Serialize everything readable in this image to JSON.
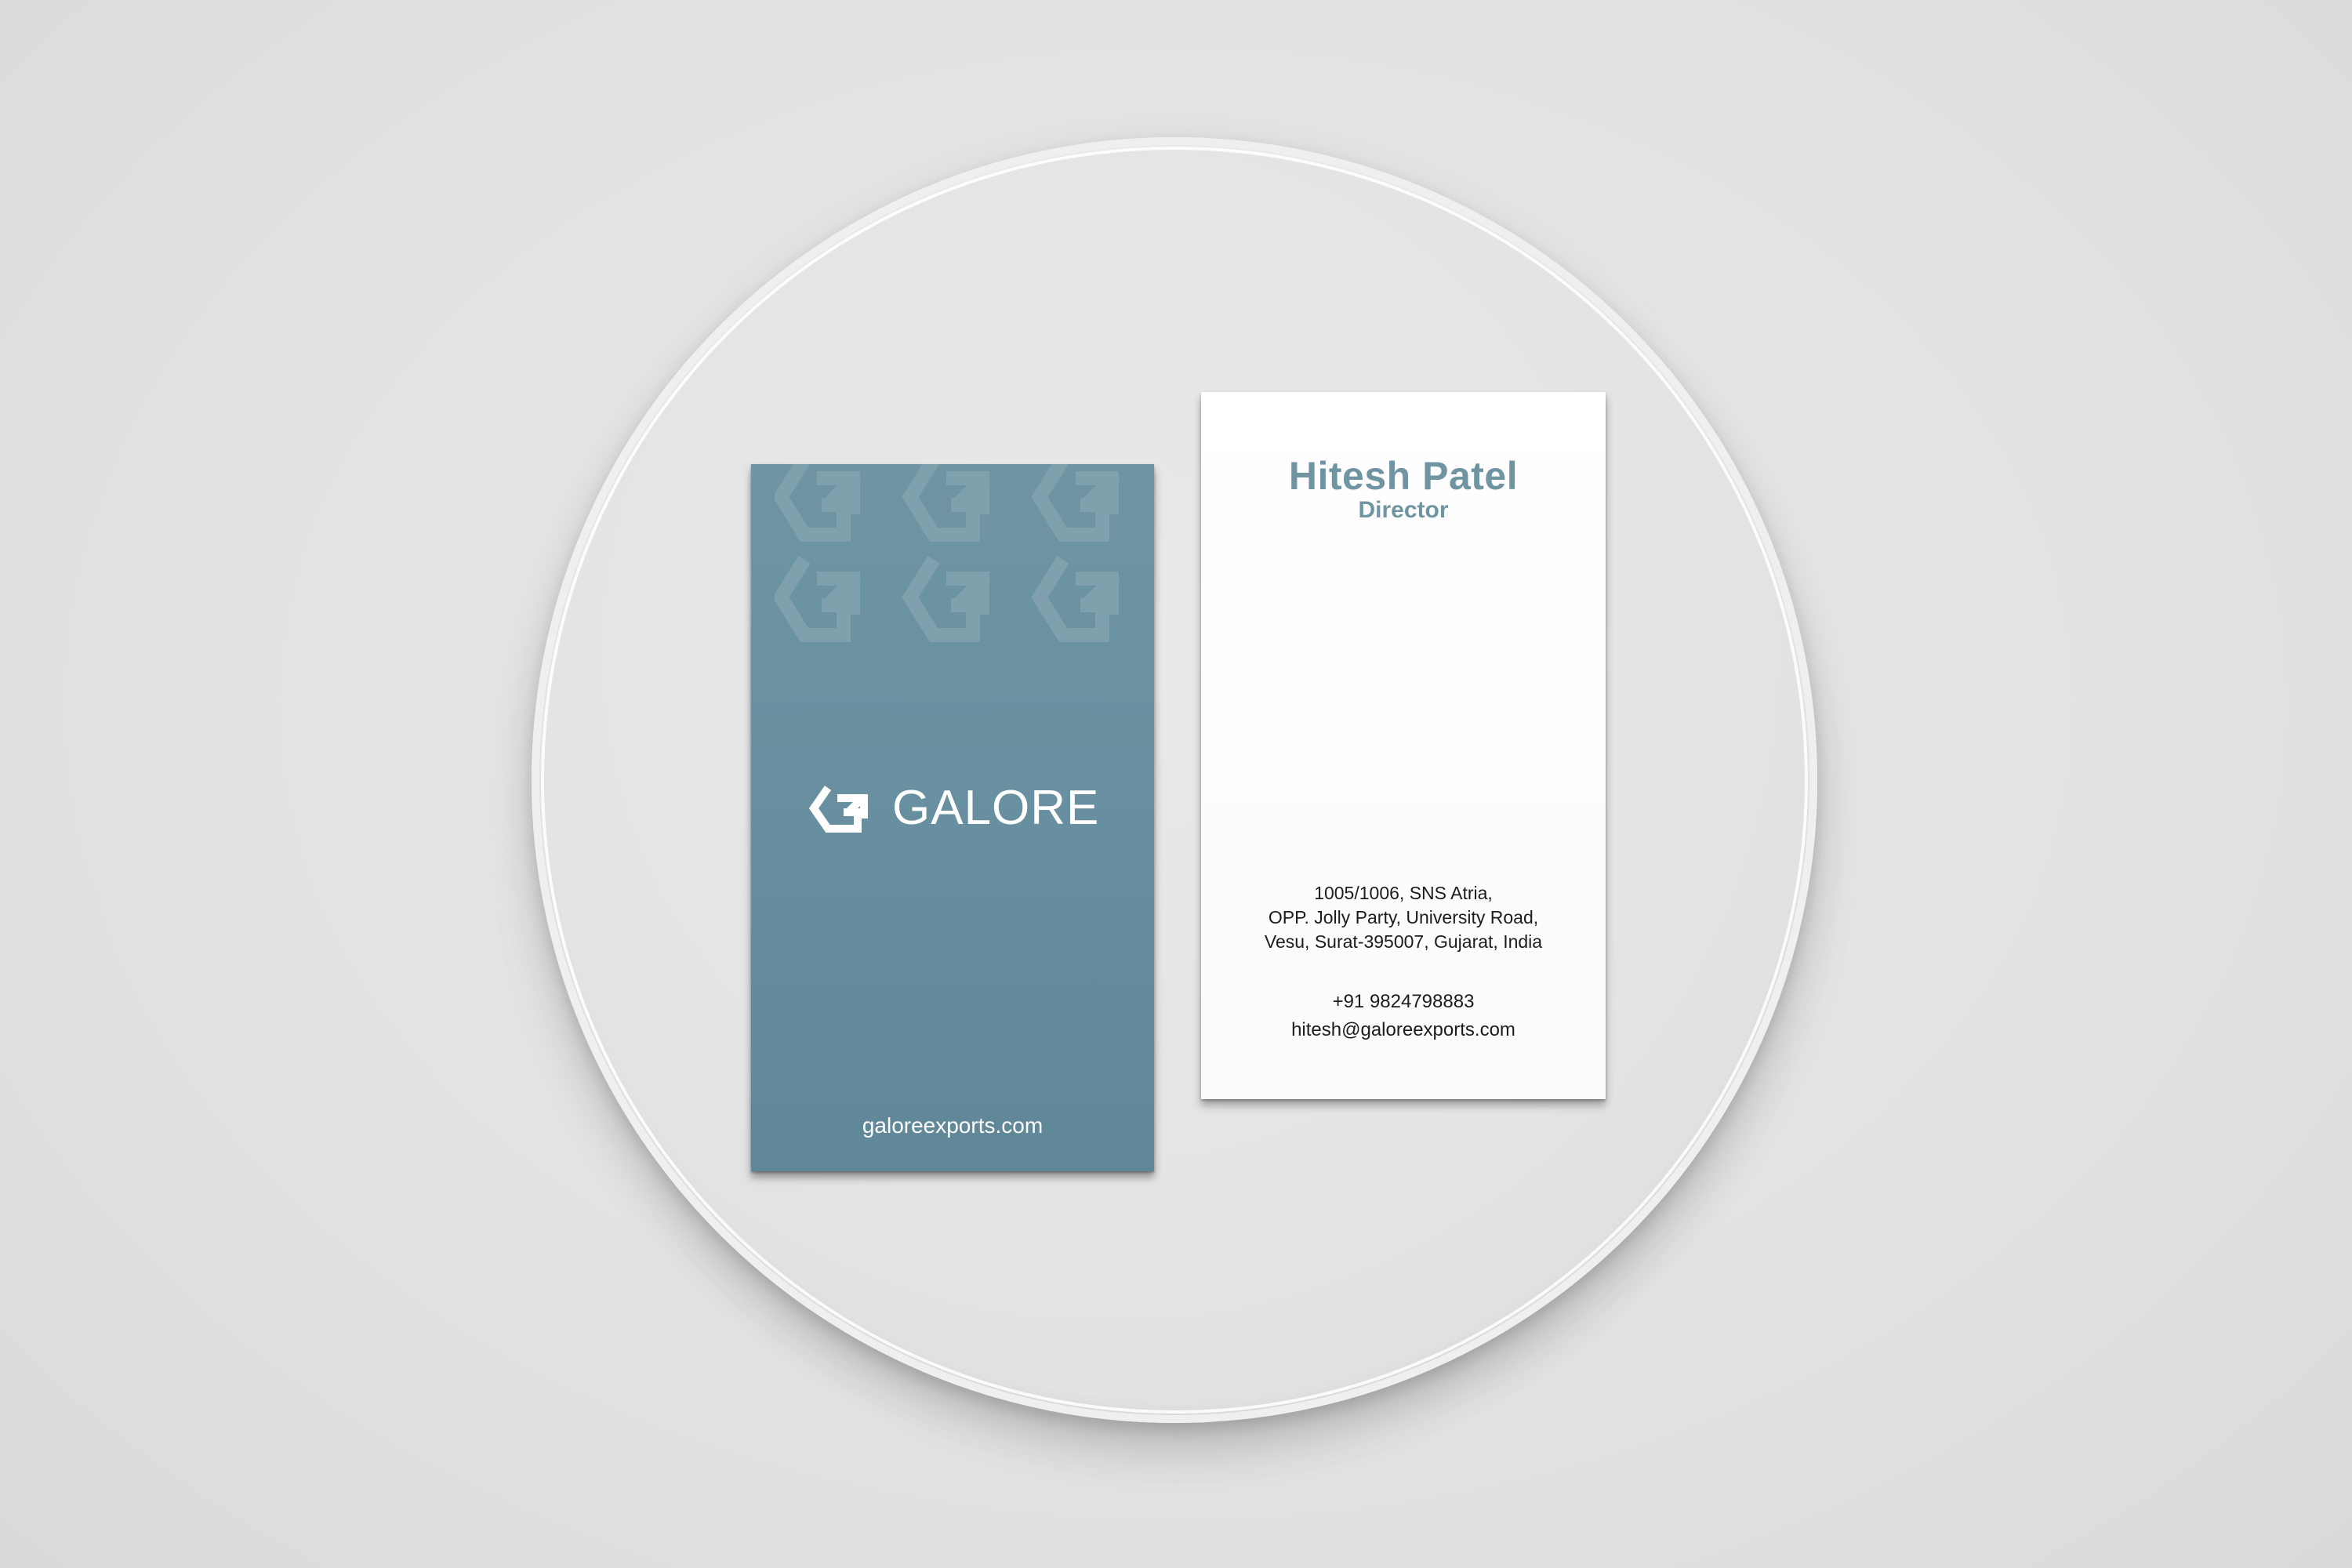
{
  "colors": {
    "background": "#e3e3e3",
    "brand_teal": "#6f95a3",
    "card_white": "#ffffff",
    "text_dark": "#1c1c1c"
  },
  "front_card": {
    "brand_name": "GALORE",
    "logo_icon": "galore-g-arrow-icon",
    "pattern_icon": "galore-g-arrow-icon",
    "website": "galoreexports.com"
  },
  "back_card": {
    "name": "Hitesh Patel",
    "title": "Director",
    "address_lines": [
      "1005/1006, SNS Atria,",
      "OPP. Jolly Party, University Road,",
      "Vesu, Surat-395007, Gujarat, India"
    ],
    "phone": "+91 9824798883",
    "email": "hitesh@galoreexports.com"
  }
}
